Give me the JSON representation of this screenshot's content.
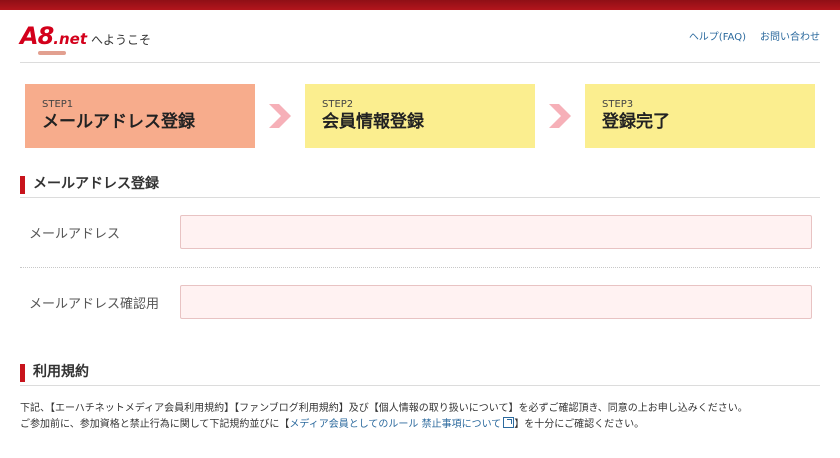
{
  "header": {
    "logo_main": "A8",
    "logo_net": ".net",
    "welcome": "へようこそ",
    "help_link": "ヘルプ(FAQ)",
    "contact_link": "お問い合わせ"
  },
  "steps": [
    {
      "num": "STEP1",
      "title": "メールアドレス登録"
    },
    {
      "num": "STEP2",
      "title": "会員情報登録"
    },
    {
      "num": "STEP3",
      "title": "登録完了"
    }
  ],
  "email_section": {
    "title": "メールアドレス登録",
    "email_label": "メールアドレス",
    "email_value": "",
    "confirm_label": "メールアドレス確認用",
    "confirm_value": ""
  },
  "terms_section": {
    "title": "利用規約",
    "line1": "下記、【エーハチネットメディア会員利用規約】【ファンブログ利用規約】及び【個人情報の取り扱いについて】を必ずご確認頂き、同意の上お申し込みください。",
    "line2_prefix": "ご参加前に、参加資格と禁止行為に関して下記規約並びに【",
    "line2_link1": "メディア会員としてのルール",
    "line2_link2": "禁止事項について",
    "line2_suffix": "】を十分にご確認ください。"
  },
  "colors": {
    "brand_red": "#c8141c",
    "step_active": "#f7ac8c",
    "step_idle": "#fbee8f",
    "arrow": "#f6b0b8",
    "input_bg": "#fff2f2",
    "link": "#2c6a9e"
  }
}
